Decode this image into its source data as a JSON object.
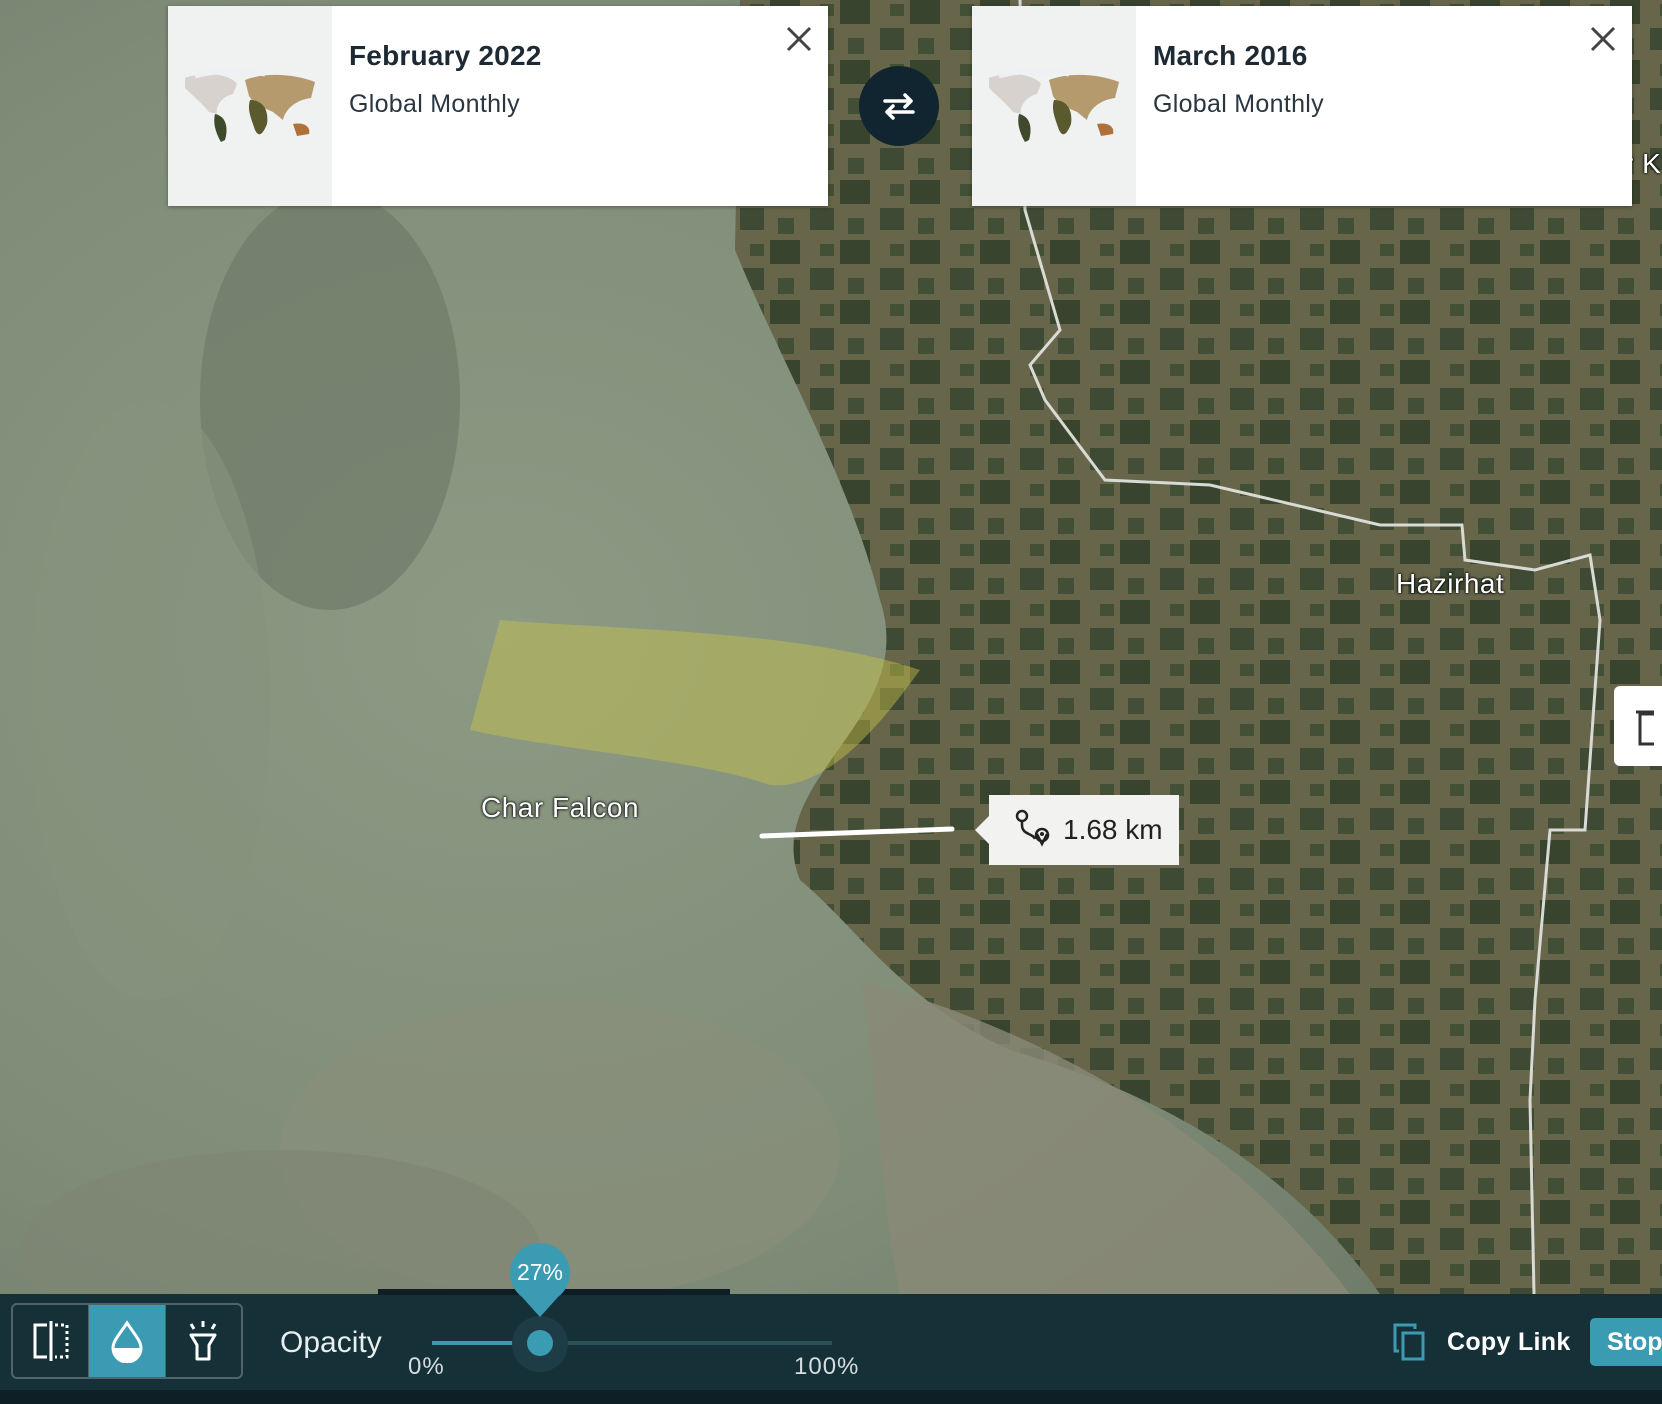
{
  "compare": {
    "left": {
      "title": "February 2022",
      "subtitle": "Global Monthly",
      "thumbnail_icon": "world-map-icon",
      "close_icon": "close-icon"
    },
    "right": {
      "title": "March 2016",
      "subtitle": "Global Monthly",
      "thumbnail_icon": "world-map-icon",
      "close_icon": "close-icon"
    },
    "swap_icon": "swap-arrows-icon"
  },
  "map": {
    "places": {
      "char_falcon": "Char Falcon",
      "hazirhat": "Hazirhat",
      "edge_label": "r K"
    },
    "measurement": {
      "icon": "route-icon",
      "value": "1.68 km"
    }
  },
  "toolbar": {
    "tools": [
      {
        "name": "split-compare-icon",
        "active": false
      },
      {
        "name": "opacity-drop-icon",
        "active": true
      },
      {
        "name": "spotlight-icon",
        "active": false
      }
    ],
    "opacity": {
      "label": "Opacity",
      "value": 0.27,
      "value_label": "27%",
      "min_label": "0%",
      "max_label": "100%"
    },
    "copy_link_label": "Copy Link",
    "copy_icon": "copy-icon",
    "stop_label": "Stop"
  },
  "colors": {
    "accent": "#3a9bb3",
    "toolbar_bg": "#163038",
    "swap_bg": "#112530"
  }
}
